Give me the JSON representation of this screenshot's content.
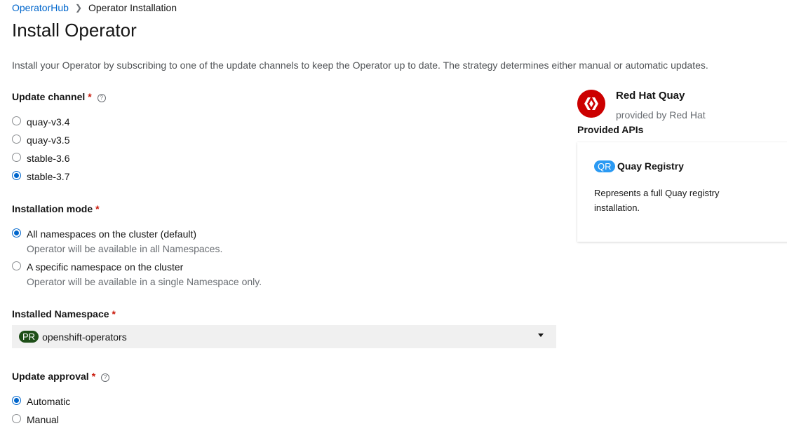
{
  "breadcrumb": {
    "parent": "OperatorHub",
    "current": "Operator Installation",
    "separator_icon": "chevron-right-icon"
  },
  "page_title": "Install Operator",
  "description": "Install your Operator by subscribing to one of the update channels to keep the Operator up to date. The strategy determines either manual or automatic updates.",
  "update_channel": {
    "label": "Update channel",
    "required": "*",
    "help": "?",
    "options": [
      {
        "label": "quay-v3.4",
        "selected": false
      },
      {
        "label": "quay-v3.5",
        "selected": false
      },
      {
        "label": "stable-3.6",
        "selected": false
      },
      {
        "label": "stable-3.7",
        "selected": true
      }
    ]
  },
  "installation_mode": {
    "label": "Installation mode",
    "required": "*",
    "options": [
      {
        "label": "All namespaces on the cluster (default)",
        "description": "Operator will be available in all Namespaces.",
        "selected": true
      },
      {
        "label": "A specific namespace on the cluster",
        "description": "Operator will be available in a single Namespace only.",
        "selected": false
      }
    ]
  },
  "installed_namespace": {
    "label": "Installed Namespace",
    "required": "*",
    "badge": "PR",
    "value": "openshift-operators"
  },
  "update_approval": {
    "label": "Update approval",
    "required": "*",
    "help": "?",
    "options": [
      {
        "label": "Automatic",
        "selected": true
      },
      {
        "label": "Manual",
        "selected": false
      }
    ]
  },
  "operator": {
    "name": "Red Hat Quay",
    "provider": "provided by Red Hat",
    "provided_apis_label": "Provided APIs",
    "api": {
      "badge": "QR",
      "name": "Quay Registry",
      "description": "Represents a full Quay registry installation."
    }
  },
  "colors": {
    "link": "#0066cc",
    "required": "#c9190b",
    "namespace_badge": "#1e4f18",
    "api_badge": "#2b9af3",
    "logo": "#cc0000"
  }
}
